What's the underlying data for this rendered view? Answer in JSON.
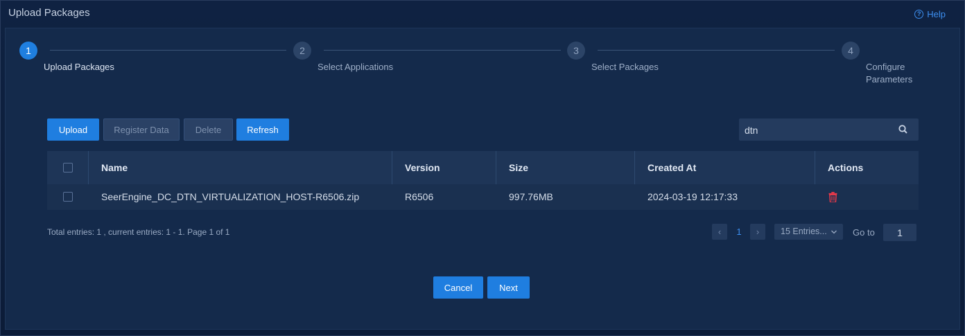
{
  "window": {
    "title": "Upload Packages",
    "help_label": "Help"
  },
  "steps": [
    {
      "number": "1",
      "label": "Upload Packages"
    },
    {
      "number": "2",
      "label": "Select Applications"
    },
    {
      "number": "3",
      "label": "Select Packages"
    },
    {
      "number": "4",
      "label_line1": "Configure",
      "label_line2": "Parameters"
    }
  ],
  "toolbar": {
    "upload_label": "Upload",
    "register_label": "Register Data",
    "delete_label": "Delete",
    "refresh_label": "Refresh",
    "search_value": "dtn"
  },
  "table": {
    "columns": [
      "Name",
      "Version",
      "Size",
      "Created At",
      "Actions"
    ],
    "rows": [
      {
        "name": "SeerEngine_DC_DTN_VIRTUALIZATION_HOST-R6506.zip",
        "version": "R6506",
        "size": "997.76MB",
        "created_at": "2024-03-19 12:17:33",
        "action_icon": "trash-icon"
      }
    ]
  },
  "pagination": {
    "summary": "Total entries: 1 , current entries: 1 - 1. Page 1 of 1",
    "current_page": "1",
    "page_size": "15 Entries...",
    "goto_label": "Go to",
    "goto_value": "1"
  },
  "footer": {
    "cancel_label": "Cancel",
    "next_label": "Next"
  },
  "colors": {
    "accent": "#1f7ee0",
    "danger": "#e8394a",
    "background": "#0b1a33"
  }
}
